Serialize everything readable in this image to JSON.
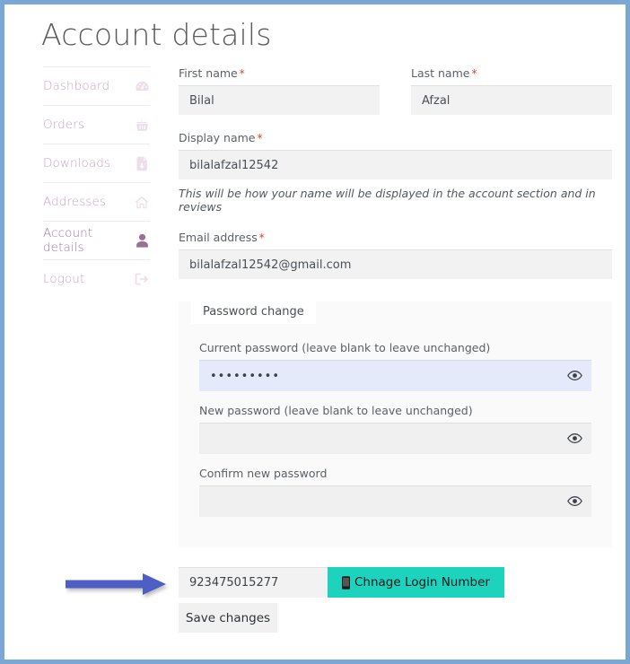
{
  "page": {
    "title": "Account details",
    "border_color": "#7ba7d4"
  },
  "sidebar": {
    "items": [
      {
        "label": "Dashboard",
        "icon": "tachometer-icon",
        "active": false
      },
      {
        "label": "Orders",
        "icon": "shopping-basket-icon",
        "active": false
      },
      {
        "label": "Downloads",
        "icon": "file-download-icon",
        "active": false
      },
      {
        "label": "Addresses",
        "icon": "home-icon",
        "active": false
      },
      {
        "label": "Account details",
        "icon": "user-icon",
        "active": true
      },
      {
        "label": "Logout",
        "icon": "sign-out-icon",
        "active": false
      }
    ]
  },
  "form": {
    "first_name": {
      "label": "First name",
      "required_marker": "*",
      "value": "Bilal",
      "placeholder": ""
    },
    "last_name": {
      "label": "Last name",
      "required_marker": "*",
      "value": "Afzal",
      "placeholder": ""
    },
    "display_name": {
      "label": "Display name",
      "required_marker": "*",
      "value": "bilalafzal12542",
      "placeholder": "",
      "helper": "This will be how your name will be displayed in the account section and in reviews"
    },
    "email": {
      "label": "Email address",
      "required_marker": "*",
      "value": "bilalafzal12542@gmail.com",
      "placeholder": ""
    }
  },
  "password_change": {
    "legend": "Password change",
    "current": {
      "label": "Current password (leave blank to leave unchanged)",
      "value": "•••••••••",
      "placeholder": "",
      "autofilled": true,
      "toggle_icon": "eye-icon"
    },
    "new": {
      "label": "New password (leave blank to leave unchanged)",
      "value": "",
      "placeholder": "",
      "autofilled": false,
      "toggle_icon": "eye-icon"
    },
    "confirm": {
      "label": "Confirm new password",
      "value": "",
      "placeholder": "",
      "autofilled": false,
      "toggle_icon": "eye-icon"
    }
  },
  "login_number": {
    "value": "923475015277",
    "placeholder": "",
    "button_label": "Chnage Login Number",
    "button_icon": "mobile-phone-icon",
    "button_color": "#1ed3bd"
  },
  "save": {
    "label": "Save changes"
  },
  "annotation": {
    "arrow_color": "#4d5fc4",
    "points_to": "login_number"
  }
}
